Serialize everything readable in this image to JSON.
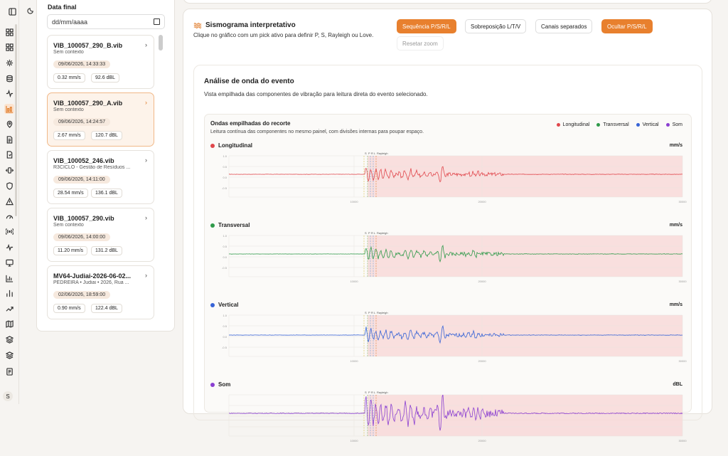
{
  "sidebar_panel": {
    "date_label": "Data final",
    "date_placeholder": "dd/mm/aaaa",
    "files": [
      {
        "name": "VIB_100057_290_B.vib",
        "context": "Sem contexto",
        "datetime": "09/06/2026, 14:33:33",
        "velocity": "0.32 mm/s",
        "sound": "92.6 dBL",
        "selected": false
      },
      {
        "name": "VIB_100057_290_A.vib",
        "context": "Sem contexto",
        "datetime": "09/06/2026, 14:24:57",
        "velocity": "2.67 mm/s",
        "sound": "120.7 dBL",
        "selected": true
      },
      {
        "name": "VIB_100052_246.vib",
        "context": "R3CICLO - Gestão de Resíduos ...",
        "datetime": "09/06/2026, 14:11:00",
        "velocity": "28.54 mm/s",
        "sound": "136.1 dBL",
        "selected": false
      },
      {
        "name": "VIB_100057_290.vib",
        "context": "Sem contexto",
        "datetime": "09/06/2026, 14:00:00",
        "velocity": "11.20 mm/s",
        "sound": "131.2 dBL",
        "selected": false
      },
      {
        "name": "MV64-Judiai-2026-06-02...",
        "context": "PEDREIRA • Judiai • 2026, Rua ...",
        "datetime": "02/06/2026, 18:59:00",
        "velocity": "0.90 mm/s",
        "sound": "122.4 dBL",
        "selected": false
      }
    ]
  },
  "rail": {
    "icons": [
      "sidebar-toggle-icon",
      "dashboard-icon",
      "grid-icon",
      "settings-icon",
      "database-icon",
      "activity-icon",
      "chart-icon",
      "map-pin-icon",
      "document-icon",
      "file-icon",
      "vibration-icon",
      "shield-icon",
      "alert-icon",
      "gauge-icon",
      "broadcast-icon",
      "pulse-icon",
      "monitor-icon",
      "bar-chart-icon",
      "bar-chart-2-icon",
      "trending-icon",
      "map-icon",
      "layers-icon",
      "stack-icon",
      "report-icon"
    ],
    "avatar": "S",
    "theme_icon": "moon-icon"
  },
  "seismogram": {
    "title": "Sismograma interpretativo",
    "description": "Clique no gráfico com um pick ativo para definir P, S, Rayleigh ou Love.",
    "buttons": [
      {
        "label": "Sequência P/S/R/L",
        "active": true
      },
      {
        "label": "Sobreposição L/T/V",
        "active": false
      },
      {
        "label": "Canais separados",
        "active": false
      },
      {
        "label": "Ocultar P/S/R/L",
        "active": true
      }
    ],
    "reset_label": "Resetar zoom"
  },
  "analysis": {
    "title": "Análise de onda do evento",
    "subtitle": "Vista empilhada das componentes de vibração para leitura direta do evento selecionado."
  },
  "chart_data": {
    "type": "line",
    "title": "Ondas empilhadas do recorte",
    "subtitle": "Leitura contínua das componentes no mesmo painel, com divisões internas para poupar espaço.",
    "legend": [
      "Longitudinal",
      "Transversal",
      "Vertical",
      "Som"
    ],
    "legend_placement": "top-right",
    "phase_markers": [
      "S",
      "P",
      "R",
      "L",
      "Rayleigh"
    ],
    "x_ticks": [
      "",
      "10000",
      "20000",
      "30000"
    ],
    "channels": [
      {
        "name": "Longitudinal",
        "unit": "mm/s",
        "color": "#e0474c",
        "y_ticks": [
          "1.0",
          "0.5",
          "0.0",
          "-0.5"
        ]
      },
      {
        "name": "Transversal",
        "unit": "mm/s",
        "color": "#2f9a4a",
        "y_ticks": [
          "1.0",
          "0.5",
          "0.0",
          "-0.5"
        ]
      },
      {
        "name": "Vertical",
        "unit": "mm/s",
        "color": "#3763d6",
        "y_ticks": [
          "1.0",
          "0.5",
          "0.0",
          "-0.5"
        ]
      },
      {
        "name": "Som",
        "unit": "dBL",
        "color": "#8a3fd1",
        "y_ticks": []
      }
    ]
  }
}
